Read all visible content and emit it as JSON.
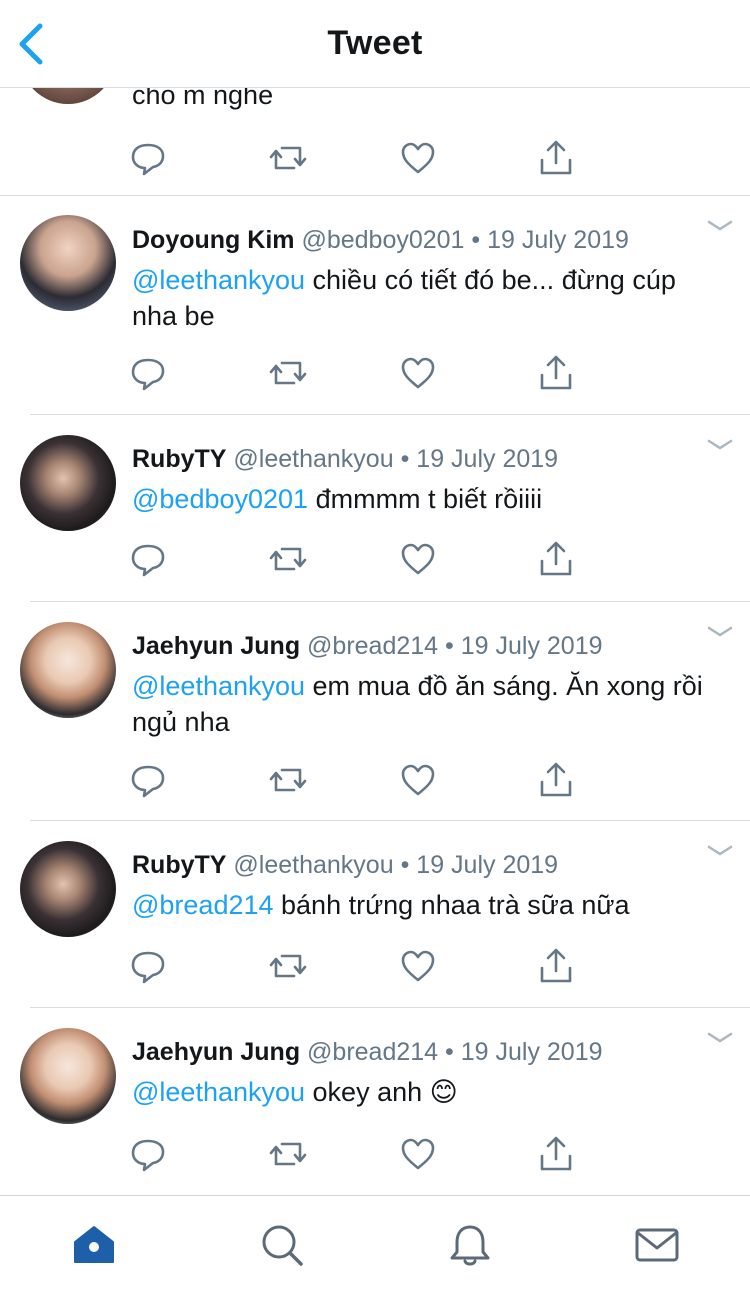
{
  "header": {
    "title": "Tweet"
  },
  "previous": {
    "text": "cho m nghe"
  },
  "tweets": [
    {
      "name": "Doyoung Kim",
      "handle": "@bedboy0201",
      "dot": "•",
      "date": "19 July 2019",
      "mention": "@leethankyou",
      "text": " chiều có tiết đó be... đừng cúp nha be",
      "avatar": "avatar-doyoung"
    },
    {
      "name": "RubyTY",
      "handle": "@leethankyou",
      "dot": "•",
      "date": "19 July 2019",
      "mention": "@bedboy0201",
      "text": " đmmmm t biết rồiiii",
      "avatar": "avatar-rubyty"
    },
    {
      "name": "Jaehyun Jung",
      "handle": "@bread214",
      "dot": "•",
      "date": "19 July 2019",
      "mention": "@leethankyou",
      "text": " em mua đồ ăn sáng. Ăn xong rồi ngủ nha",
      "avatar": "avatar-jaehyun"
    },
    {
      "name": "RubyTY",
      "handle": "@leethankyou",
      "dot": "•",
      "date": "19 July 2019",
      "mention": "@bread214",
      "text": " bánh trứng nhaa trà sữa nữa",
      "avatar": "avatar-rubyty"
    },
    {
      "name": "Jaehyun Jung",
      "handle": "@bread214",
      "dot": "•",
      "date": "19 July 2019",
      "mention": "@leethankyou",
      "text": " okey anh 😊",
      "avatar": "avatar-jaehyun"
    }
  ],
  "icons": {
    "back": "chevron-left-icon",
    "more": "chevron-down-icon",
    "reply": "reply-icon",
    "retweet": "retweet-icon",
    "like": "heart-icon",
    "share": "share-icon",
    "tabs": [
      "home-icon",
      "search-icon",
      "bell-icon",
      "mail-icon"
    ]
  },
  "colors": {
    "accent": "#1da1f2",
    "text": "#14171a",
    "muted": "#657786",
    "tab_active": "#1d5fa8",
    "tab_inactive": "#5c6a78"
  }
}
